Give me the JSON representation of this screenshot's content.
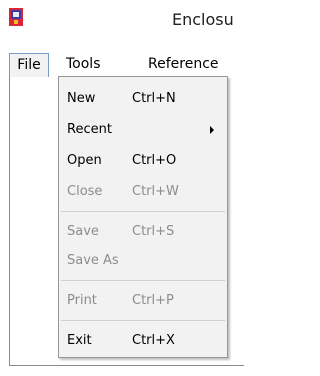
{
  "window": {
    "title": "Enclosu",
    "icon": "app-flag-icon"
  },
  "menubar": {
    "items": [
      {
        "label": "File",
        "active": true
      },
      {
        "label": "Tools",
        "active": false
      },
      {
        "label": "Reference",
        "active": false
      }
    ]
  },
  "file_menu": {
    "new": {
      "label": "New",
      "shortcut": "Ctrl+N",
      "enabled": true
    },
    "recent": {
      "label": "Recent",
      "has_submenu": true,
      "enabled": true
    },
    "open": {
      "label": "Open",
      "shortcut": "Ctrl+O",
      "enabled": true
    },
    "close": {
      "label": "Close",
      "shortcut": "Ctrl+W",
      "enabled": false
    },
    "save": {
      "label": "Save",
      "shortcut": "Ctrl+S",
      "enabled": false
    },
    "save_as": {
      "label": "Save As",
      "enabled": false
    },
    "print": {
      "label": "Print",
      "shortcut": "Ctrl+P",
      "enabled": false
    },
    "exit": {
      "label": "Exit",
      "shortcut": "Ctrl+X",
      "enabled": true
    }
  },
  "colors": {
    "menu_background": "#f2f2f2",
    "disabled_text": "#8c8c8c",
    "active_border": "#7a9cc8"
  }
}
